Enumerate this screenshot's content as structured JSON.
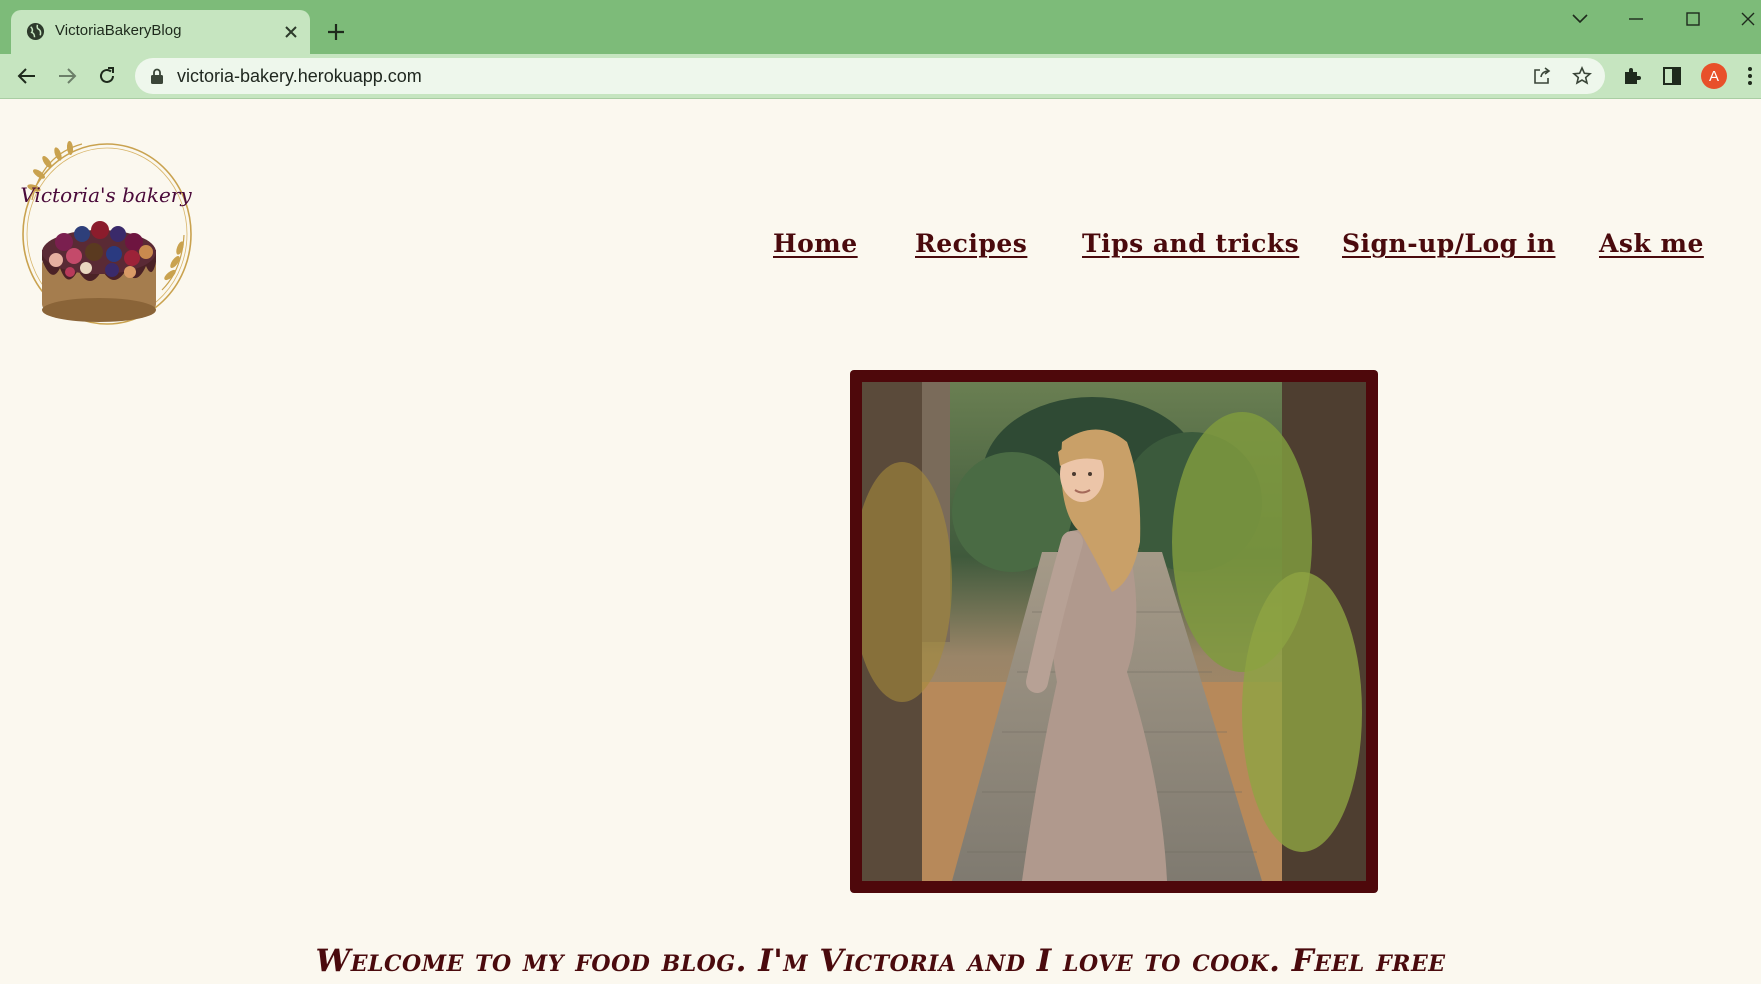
{
  "browser": {
    "tab_title": "VictoriaBakeryBlog",
    "url": "victoria-bakery.herokuapp.com",
    "profile_initial": "A",
    "theme_color": "#7dbb79",
    "toolbar_color": "#c6e5c0"
  },
  "page": {
    "logo_text": "Victoria's bakery",
    "nav": {
      "home": "Home",
      "recipes": "Recipes",
      "tips": "Tips and tricks",
      "signup": "Sign-up/Log in",
      "ask": "Ask me"
    },
    "welcome_text": "Welcome to my food blog. I'm Victoria and I love to cook. Feel free",
    "accent_color": "#4a0a0d",
    "background_color": "#fbf8ef"
  }
}
